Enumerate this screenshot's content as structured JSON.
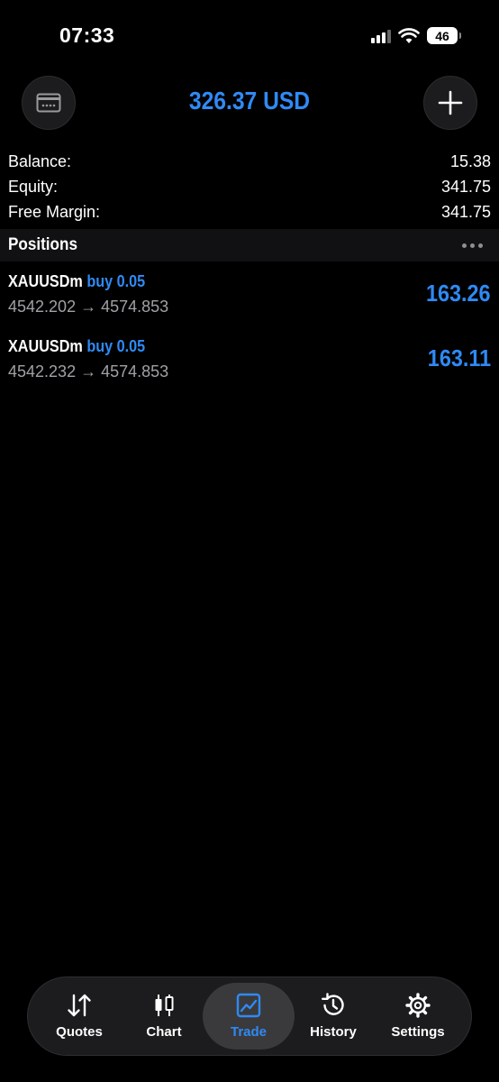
{
  "status_bar": {
    "time": "07:33",
    "battery": "46",
    "icons": [
      "signal-icon",
      "wifi-icon",
      "battery-icon"
    ]
  },
  "header": {
    "title": "326.37 USD",
    "left_icon": "card-icon",
    "right_icon": "plus-icon"
  },
  "summary": [
    {
      "label": "Balance:",
      "value": "15.38"
    },
    {
      "label": "Equity:",
      "value": "341.75"
    },
    {
      "label": "Free Margin:",
      "value": "341.75"
    }
  ],
  "positions_section": {
    "title": "Positions",
    "menu_icon": "more-icon"
  },
  "positions": [
    {
      "symbol": "XAUUSDm",
      "side": "buy 0.05",
      "open_price": "4542.202",
      "arrow": "→",
      "current_price": "4574.853",
      "profit": "163.26"
    },
    {
      "symbol": "XAUUSDm",
      "side": "buy 0.05",
      "open_price": "4542.232",
      "arrow": "→",
      "current_price": "4574.853",
      "profit": "163.11"
    }
  ],
  "tabs": [
    {
      "label": "Quotes",
      "icon": "sort-arrows-icon"
    },
    {
      "label": "Chart",
      "icon": "candlestick-icon"
    },
    {
      "label": "Trade",
      "icon": "trend-chart-icon",
      "active": true
    },
    {
      "label": "History",
      "icon": "history-icon"
    },
    {
      "label": "Settings",
      "icon": "gear-icon"
    }
  ],
  "colors": {
    "accent": "#2f8af5",
    "background": "#000000",
    "secondary_text": "#a1a1a6"
  }
}
